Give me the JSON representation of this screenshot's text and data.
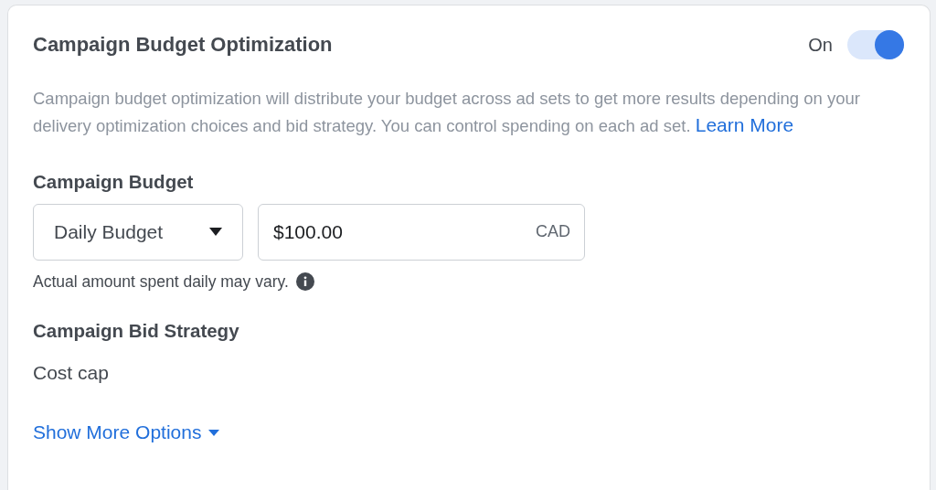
{
  "card": {
    "title": "Campaign Budget Optimization",
    "toggle": {
      "label": "On",
      "on": true
    },
    "description": {
      "text": "Campaign budget optimization will distribute your budget across ad sets to get more results depending on your delivery optimization choices and bid strategy. You can control spending on each ad set.",
      "link": "Learn More"
    },
    "budget": {
      "label": "Campaign Budget",
      "budget_type": {
        "value": "Daily Budget"
      },
      "amount": {
        "value": "$100.00",
        "currency": "CAD"
      },
      "hint": "Actual amount spent daily may vary."
    },
    "bid_strategy": {
      "label": "Campaign Bid Strategy",
      "value": "Cost cap"
    },
    "more_link": "Show More Options"
  }
}
